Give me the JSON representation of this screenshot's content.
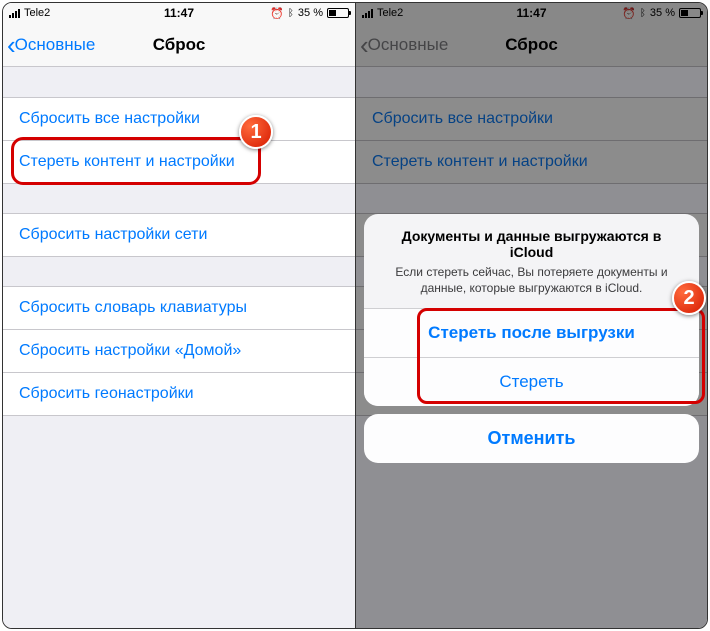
{
  "status": {
    "carrier": "Tele2",
    "time": "11:47",
    "battery_pct": "35 %"
  },
  "nav": {
    "back": "Основные",
    "title": "Сброс"
  },
  "groups": [
    {
      "items": [
        {
          "label": "Сбросить все настройки"
        },
        {
          "label": "Стереть контент и настройки"
        }
      ]
    },
    {
      "items": [
        {
          "label": "Сбросить настройки сети"
        }
      ]
    },
    {
      "items": [
        {
          "label": "Сбросить словарь клавиатуры"
        },
        {
          "label": "Сбросить настройки «Домой»"
        },
        {
          "label": "Сбросить геонастройки"
        }
      ]
    }
  ],
  "modal": {
    "title": "Документы и данные выгружаются в iCloud",
    "message": "Если стереть сейчас, Вы потеряете документы и данные, которые выгружаются в iCloud.",
    "option1": "Стереть после выгрузки",
    "option2": "Стереть",
    "cancel": "Отменить"
  },
  "badges": {
    "one": "1",
    "two": "2"
  }
}
